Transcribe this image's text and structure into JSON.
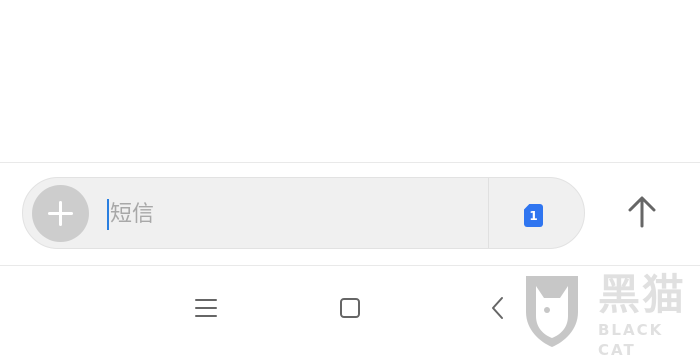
{
  "compose": {
    "placeholder": "短信",
    "value": "",
    "sim_slot_label": "1",
    "add_icon": "plus-icon",
    "send_icon": "arrow-up-icon"
  },
  "navigation": {
    "menu_icon": "menu-icon",
    "home_icon": "square-home-icon",
    "back_icon": "chevron-left-icon"
  },
  "watermark": {
    "logo_cn": "黑猫",
    "logo_en": "BLACK CAT"
  },
  "colors": {
    "input_background": "#f0f0f0",
    "add_button": "#cdcdcd",
    "sim_accent": "#2f75f0",
    "cursor": "#2a7fe0",
    "icon_gray": "#666666"
  }
}
